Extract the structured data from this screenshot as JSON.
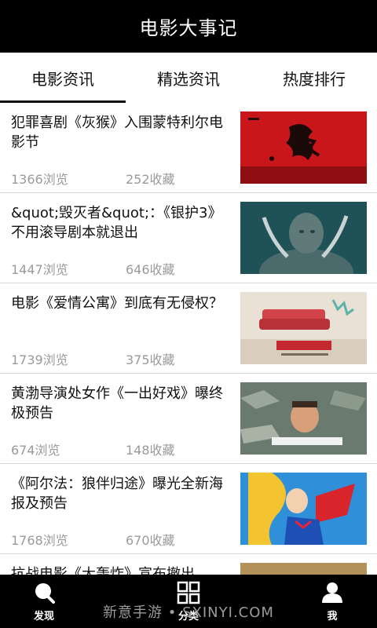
{
  "app": {
    "title": "电影大事记"
  },
  "tabs": [
    {
      "label": "电影资讯",
      "active": true
    },
    {
      "label": "精选资讯",
      "active": false
    },
    {
      "label": "热度排行",
      "active": false
    }
  ],
  "articles": [
    {
      "title": "犯罪喜剧《灰猴》入围蒙特利尔电影节",
      "views": "1366浏览",
      "favorites": "252收藏"
    },
    {
      "title": "&quot;毁灭者&quot;：《银护3》不用滚导剧本就退出",
      "views": "1447浏览",
      "favorites": "646收藏"
    },
    {
      "title": "电影《爱情公寓》到底有无侵权？",
      "views": "1739浏览",
      "favorites": "375收藏"
    },
    {
      "title": "黄渤导演处女作《一出好戏》曝终极预告",
      "views": "674浏览",
      "favorites": "148收藏"
    },
    {
      "title": "《阿尔法：狼伴归途》曝光全新海报及预告",
      "views": "1768浏览",
      "favorites": "670收藏"
    },
    {
      "title": "抗战电影《大轰炸》宣布撤出",
      "views": "",
      "favorites": ""
    }
  ],
  "nav": {
    "discover": "发现",
    "category": "分类",
    "me": "我"
  },
  "watermark": "新意手游 • SXINYI.COM",
  "colors": {
    "bar": "#000000",
    "meta": "#9a9a9a",
    "divider": "#d9d9d9"
  }
}
